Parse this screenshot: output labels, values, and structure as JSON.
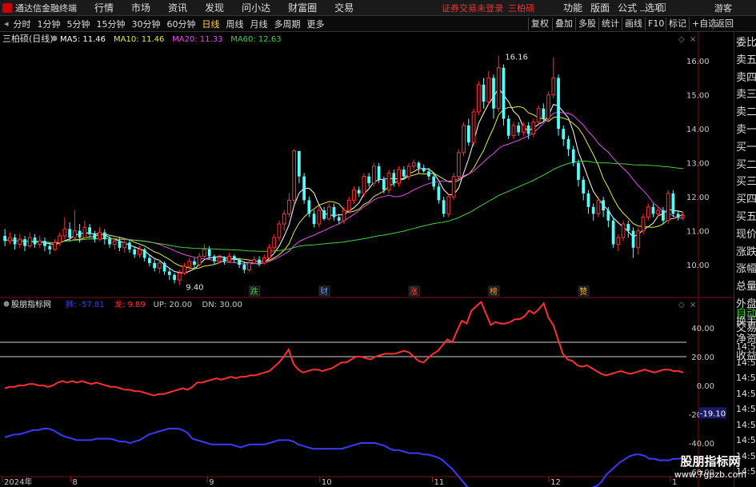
{
  "app_title": "通达信金融终端",
  "menu": {
    "items": [
      "行情",
      "市场",
      "资讯",
      "发现",
      "问小达",
      "财富圈",
      "交易"
    ],
    "warning": "证券交易未登录",
    "stock_name": "三柏硕",
    "right_items": [
      "功能",
      "版面",
      "公式",
      "选项"
    ],
    "guest": "游客"
  },
  "toolbar": {
    "periods": [
      "分时",
      "1分钟",
      "5分钟",
      "15分钟",
      "30分钟",
      "60分钟",
      "日线",
      "周线",
      "月线",
      "多周期",
      "更多"
    ],
    "active": "日线",
    "right_buttons": [
      "复权",
      "叠加",
      "多股",
      "统计",
      "画线",
      "F10",
      "标记",
      "+自选",
      "返回"
    ]
  },
  "legend_main": {
    "title": "三柏硕(日线)",
    "ma": [
      {
        "label": "MA5: 11.46",
        "color": "#ffffff"
      },
      {
        "label": "MA10: 11.46",
        "color": "#e8e84a"
      },
      {
        "label": "MA20: 11.33",
        "color": "#e64ee6"
      },
      {
        "label": "MA60: 12.63",
        "color": "#3fd13f"
      }
    ]
  },
  "legend_ind": {
    "title": "股朋指标网",
    "items": [
      {
        "label": "狮: -57.81",
        "color": "#3a3aff"
      },
      {
        "label": "龙: 9.89",
        "color": "#ff3030"
      },
      {
        "label": "UP: 20.00",
        "color": "#c8c8c8"
      },
      {
        "label": "DN: 30.00",
        "color": "#c8c8c8"
      }
    ]
  },
  "right_panel": {
    "items": [
      "委比",
      "卖五",
      "卖四",
      "卖三",
      "卖二",
      "卖一",
      "买一",
      "买二",
      "买三",
      "买四",
      "买五",
      "现价",
      "涨跌",
      "涨幅",
      "总量",
      "外盘",
      "换手",
      "净资",
      "收益"
    ],
    "trade": [
      "自动",
      "交易"
    ],
    "times": [
      "14:56",
      "14:56",
      "14:56",
      "14:56",
      "14:56",
      "14:56",
      "14:56",
      "14:56",
      "14:56"
    ]
  },
  "axis_x": {
    "labels": [
      "2024年",
      "8",
      "9",
      "10",
      "11",
      "12",
      "1"
    ]
  },
  "badges": [
    "跌",
    "财",
    "涨",
    "榜",
    "赞"
  ],
  "watermark": {
    "title": "股朋指标网",
    "url": "www.7gpzb.com"
  },
  "chart_data": [
    {
      "type": "candlestick",
      "title": "三柏硕(日线)",
      "ylim": [
        9.2,
        16.5
      ],
      "y_ticks": [
        10.0,
        11.0,
        12.0,
        13.0,
        14.0,
        15.0,
        16.0
      ],
      "annotations": [
        {
          "label": "16.16",
          "value": 16.16
        },
        {
          "label": "9.40",
          "value": 9.4
        }
      ],
      "series": [
        {
          "name": "MA5",
          "color": "#ffffff"
        },
        {
          "name": "MA10",
          "color": "#e8e84a"
        },
        {
          "name": "MA20",
          "color": "#e64ee6"
        },
        {
          "name": "MA60",
          "color": "#3fd13f"
        }
      ],
      "ohlc": [
        [
          10.85,
          10.7,
          11.05,
          10.55
        ],
        [
          10.7,
          10.8,
          10.95,
          10.6
        ],
        [
          10.8,
          10.6,
          10.9,
          10.45
        ],
        [
          10.6,
          10.75,
          10.9,
          10.5
        ],
        [
          10.75,
          10.55,
          10.85,
          10.4
        ],
        [
          10.55,
          10.8,
          10.95,
          10.5
        ],
        [
          10.8,
          10.6,
          10.9,
          10.5
        ],
        [
          10.6,
          10.7,
          10.85,
          10.5
        ],
        [
          10.7,
          10.55,
          10.8,
          10.4
        ],
        [
          10.55,
          10.45,
          10.65,
          10.3
        ],
        [
          10.45,
          10.65,
          10.75,
          10.4
        ],
        [
          10.65,
          10.85,
          10.95,
          10.55
        ],
        [
          10.85,
          11.05,
          11.4,
          10.75
        ],
        [
          11.05,
          10.8,
          11.25,
          10.7
        ],
        [
          10.8,
          11.0,
          11.6,
          10.7
        ],
        [
          11.0,
          10.8,
          11.2,
          10.65
        ],
        [
          10.8,
          11.1,
          11.3,
          10.75
        ],
        [
          11.1,
          10.9,
          11.2,
          10.8
        ],
        [
          10.9,
          10.75,
          11.0,
          10.65
        ],
        [
          10.75,
          10.95,
          11.1,
          10.7
        ],
        [
          10.95,
          10.75,
          11.05,
          10.6
        ],
        [
          10.75,
          10.6,
          10.85,
          10.5
        ],
        [
          10.6,
          10.7,
          10.8,
          10.45
        ],
        [
          10.7,
          10.5,
          10.8,
          10.4
        ],
        [
          10.5,
          10.65,
          10.75,
          10.35
        ],
        [
          10.65,
          10.45,
          10.75,
          10.35
        ],
        [
          10.45,
          10.3,
          10.55,
          10.2
        ],
        [
          10.3,
          10.45,
          10.55,
          10.2
        ],
        [
          10.45,
          10.2,
          10.5,
          10.1
        ],
        [
          10.2,
          10.05,
          10.3,
          9.95
        ],
        [
          10.05,
          9.9,
          10.15,
          9.8
        ],
        [
          9.9,
          10.05,
          10.15,
          9.75
        ],
        [
          10.05,
          9.8,
          10.1,
          9.7
        ],
        [
          9.8,
          9.7,
          9.9,
          9.55
        ],
        [
          9.7,
          9.55,
          9.75,
          9.45
        ],
        [
          9.55,
          9.75,
          9.85,
          9.4
        ],
        [
          9.75,
          9.95,
          10.05,
          9.7
        ],
        [
          9.95,
          10.1,
          10.2,
          9.85
        ],
        [
          10.1,
          10.0,
          10.2,
          9.9
        ],
        [
          10.0,
          10.25,
          10.35,
          9.95
        ],
        [
          10.25,
          10.45,
          10.6,
          10.2
        ],
        [
          10.45,
          10.25,
          10.55,
          10.15
        ],
        [
          10.25,
          10.1,
          10.3,
          10.0
        ],
        [
          10.1,
          10.2,
          10.3,
          10.05
        ],
        [
          10.2,
          10.1,
          10.25,
          10.0
        ],
        [
          10.1,
          10.25,
          10.35,
          10.05
        ],
        [
          10.25,
          10.15,
          10.3,
          10.05
        ],
        [
          10.15,
          10.0,
          10.2,
          9.9
        ],
        [
          10.0,
          9.85,
          10.1,
          9.75
        ],
        [
          9.85,
          10.05,
          10.15,
          9.8
        ],
        [
          10.05,
          10.15,
          10.25,
          10.0
        ],
        [
          10.15,
          10.05,
          10.25,
          9.95
        ],
        [
          10.05,
          10.2,
          10.3,
          10.0
        ],
        [
          10.2,
          10.5,
          10.6,
          10.15
        ],
        [
          10.5,
          10.8,
          10.9,
          10.4
        ],
        [
          10.8,
          11.2,
          11.3,
          10.7
        ],
        [
          11.2,
          11.5,
          11.6,
          11.0
        ],
        [
          11.5,
          11.9,
          12.1,
          11.4
        ],
        [
          11.9,
          13.35,
          13.4,
          11.8
        ],
        [
          13.35,
          12.6,
          12.9,
          12.4
        ],
        [
          12.6,
          11.9,
          12.7,
          11.8
        ],
        [
          11.9,
          11.5,
          12.0,
          11.4
        ],
        [
          11.5,
          11.2,
          11.6,
          11.1
        ],
        [
          11.2,
          11.6,
          11.7,
          11.1
        ],
        [
          11.6,
          11.35,
          11.7,
          11.3
        ],
        [
          11.35,
          11.7,
          11.8,
          11.3
        ],
        [
          11.7,
          11.4,
          11.8,
          11.3
        ],
        [
          11.4,
          11.3,
          11.5,
          11.2
        ],
        [
          11.3,
          11.6,
          11.7,
          11.2
        ],
        [
          11.6,
          11.9,
          12.0,
          11.5
        ],
        [
          11.9,
          12.2,
          12.3,
          11.8
        ],
        [
          12.2,
          12.1,
          12.3,
          12.0
        ],
        [
          12.1,
          12.6,
          12.7,
          12.0
        ],
        [
          12.6,
          12.4,
          12.7,
          12.3
        ],
        [
          12.4,
          12.9,
          13.0,
          12.3
        ],
        [
          12.9,
          12.5,
          13.0,
          12.4
        ],
        [
          12.5,
          12.2,
          12.6,
          12.1
        ],
        [
          12.2,
          12.7,
          12.8,
          12.1
        ],
        [
          12.7,
          12.4,
          12.8,
          12.3
        ],
        [
          12.4,
          12.8,
          12.9,
          12.3
        ],
        [
          12.8,
          12.6,
          12.9,
          12.5
        ],
        [
          12.6,
          12.9,
          13.0,
          12.5
        ],
        [
          12.9,
          13.0,
          13.1,
          12.8
        ],
        [
          13.0,
          12.85,
          13.05,
          12.7
        ],
        [
          12.85,
          12.75,
          12.95,
          12.7
        ],
        [
          12.75,
          12.6,
          12.85,
          12.5
        ],
        [
          12.6,
          12.3,
          12.7,
          12.2
        ],
        [
          12.3,
          11.9,
          12.4,
          11.8
        ],
        [
          11.9,
          11.5,
          12.0,
          11.4
        ],
        [
          11.5,
          12.0,
          12.1,
          11.4
        ],
        [
          12.0,
          12.6,
          12.7,
          11.9
        ],
        [
          12.6,
          13.3,
          13.4,
          12.5
        ],
        [
          13.3,
          14.1,
          14.2,
          13.2
        ],
        [
          14.1,
          13.6,
          14.3,
          13.5
        ],
        [
          13.6,
          14.5,
          14.6,
          13.5
        ],
        [
          14.5,
          15.3,
          15.4,
          14.4
        ],
        [
          15.3,
          14.8,
          15.5,
          14.6
        ],
        [
          14.8,
          15.5,
          15.7,
          14.7
        ],
        [
          15.5,
          14.6,
          15.6,
          14.3
        ],
        [
          14.6,
          15.8,
          16.16,
          14.5
        ],
        [
          15.8,
          14.3,
          15.9,
          14.1
        ],
        [
          14.3,
          13.8,
          14.4,
          13.7
        ],
        [
          13.8,
          14.1,
          14.2,
          13.7
        ],
        [
          14.1,
          13.9,
          14.2,
          13.8
        ],
        [
          13.9,
          14.1,
          14.2,
          13.8
        ],
        [
          14.1,
          13.85,
          14.2,
          13.7
        ],
        [
          13.85,
          14.2,
          14.3,
          13.75
        ],
        [
          14.2,
          14.6,
          14.7,
          14.1
        ],
        [
          14.6,
          14.3,
          14.75,
          14.2
        ],
        [
          14.3,
          15.0,
          15.1,
          14.2
        ],
        [
          15.0,
          15.5,
          16.1,
          14.9
        ],
        [
          15.5,
          14.0,
          15.6,
          13.8
        ],
        [
          14.0,
          13.7,
          14.1,
          13.5
        ],
        [
          13.7,
          13.4,
          13.8,
          13.2
        ],
        [
          13.4,
          13.0,
          13.5,
          12.9
        ],
        [
          13.0,
          12.5,
          13.1,
          12.3
        ],
        [
          12.5,
          12.1,
          12.6,
          11.9
        ],
        [
          12.1,
          11.7,
          12.2,
          11.5
        ],
        [
          11.7,
          11.5,
          11.8,
          11.3
        ],
        [
          11.5,
          11.9,
          12.0,
          11.4
        ],
        [
          11.9,
          11.6,
          12.0,
          11.4
        ],
        [
          11.6,
          11.3,
          11.7,
          11.1
        ],
        [
          11.3,
          10.6,
          11.4,
          10.5
        ],
        [
          10.6,
          10.8,
          10.9,
          10.4
        ],
        [
          10.8,
          11.2,
          11.3,
          10.7
        ],
        [
          11.2,
          11.0,
          11.3,
          10.8
        ],
        [
          11.0,
          10.5,
          11.1,
          10.2
        ],
        [
          10.5,
          11.0,
          11.1,
          10.3
        ],
        [
          11.0,
          11.4,
          11.5,
          10.9
        ],
        [
          11.4,
          11.7,
          11.8,
          11.3
        ],
        [
          11.7,
          11.5,
          11.8,
          11.4
        ],
        [
          11.5,
          11.6,
          11.7,
          11.4
        ],
        [
          11.6,
          11.3,
          11.7,
          11.2
        ],
        [
          11.3,
          12.1,
          12.2,
          11.2
        ],
        [
          12.1,
          11.5,
          12.2,
          11.4
        ],
        [
          11.5,
          11.4,
          11.6,
          11.3
        ],
        [
          11.4,
          11.45,
          11.55,
          11.3
        ]
      ]
    },
    {
      "type": "line",
      "title": "股朋指标网",
      "ylim": [
        -60,
        50
      ],
      "y_ticks": [
        40,
        20,
        0,
        -20,
        -40,
        -60
      ],
      "current_value": -19.1,
      "hlines": [
        {
          "name": "UP",
          "value": 20
        },
        {
          "name": "DN",
          "value": 30
        }
      ],
      "series": [
        {
          "name": "龙",
          "color": "#ff3030",
          "values": [
            -2,
            -1,
            -1,
            0,
            0,
            1,
            1,
            0,
            0,
            -1,
            0,
            2,
            3,
            2,
            3,
            2,
            3,
            2,
            1,
            2,
            1,
            0,
            -1,
            -1,
            -2,
            -3,
            -3,
            -4,
            -4,
            -5,
            -6,
            -7,
            -6,
            -6,
            -5,
            -4,
            -3,
            -2,
            -3,
            -1,
            2,
            2,
            3,
            4,
            5,
            4,
            5,
            6,
            5,
            6,
            6,
            7,
            7,
            8,
            9,
            10,
            13,
            16,
            20,
            25,
            15,
            11,
            9,
            10,
            11,
            11,
            10,
            11,
            12,
            14,
            16,
            16,
            18,
            20,
            20,
            19,
            18,
            20,
            21,
            22,
            22,
            22,
            23,
            24,
            23,
            20,
            17,
            16,
            19,
            22,
            24,
            28,
            32,
            30,
            38,
            45,
            43,
            52,
            55,
            58,
            50,
            42,
            44,
            43,
            43,
            44,
            46,
            46,
            48,
            52,
            50,
            53,
            57,
            47,
            42,
            32,
            22,
            18,
            17,
            14,
            13,
            14,
            12,
            10,
            8,
            7,
            8,
            9,
            10,
            9,
            8,
            9,
            10,
            11,
            10,
            9,
            10,
            11,
            11,
            10,
            10,
            9
          ]
        },
        {
          "name": "狮",
          "color": "#3a3aff",
          "values": [
            -36,
            -35,
            -34,
            -34,
            -33,
            -32,
            -31,
            -31,
            -30,
            -30,
            -31,
            -33,
            -35,
            -36,
            -37,
            -38,
            -38,
            -38,
            -38,
            -37,
            -37,
            -37,
            -37,
            -38,
            -39,
            -39,
            -40,
            -39,
            -38,
            -36,
            -34,
            -33,
            -32,
            -31,
            -30,
            -30,
            -30,
            -31,
            -33,
            -37,
            -38,
            -39,
            -40,
            -41,
            -41,
            -41,
            -41,
            -41,
            -42,
            -43,
            -42,
            -41,
            -41,
            -41,
            -41,
            -40,
            -39,
            -38,
            -38,
            -38,
            -39,
            -41,
            -42,
            -43,
            -44,
            -44,
            -44,
            -44,
            -44,
            -44,
            -44,
            -43,
            -42,
            -41,
            -40,
            -40,
            -40,
            -40,
            -41,
            -42,
            -44,
            -45,
            -45,
            -46,
            -47,
            -47,
            -47,
            -48,
            -48,
            -49,
            -50,
            -52,
            -55,
            -58,
            -62,
            -66,
            -70,
            -73,
            -75,
            -77,
            -79,
            -80,
            -80,
            -81,
            -81,
            -81,
            -80,
            -80,
            -79,
            -78,
            -78,
            -77,
            -76,
            -75,
            -74,
            -74,
            -74,
            -74,
            -74,
            -73,
            -73,
            -72,
            -71,
            -70,
            -67,
            -62,
            -59,
            -56,
            -53,
            -51,
            -49,
            -48,
            -48,
            -49,
            -51,
            -51,
            -52,
            -52,
            -52,
            -51,
            -51,
            -50
          ]
        }
      ]
    }
  ]
}
